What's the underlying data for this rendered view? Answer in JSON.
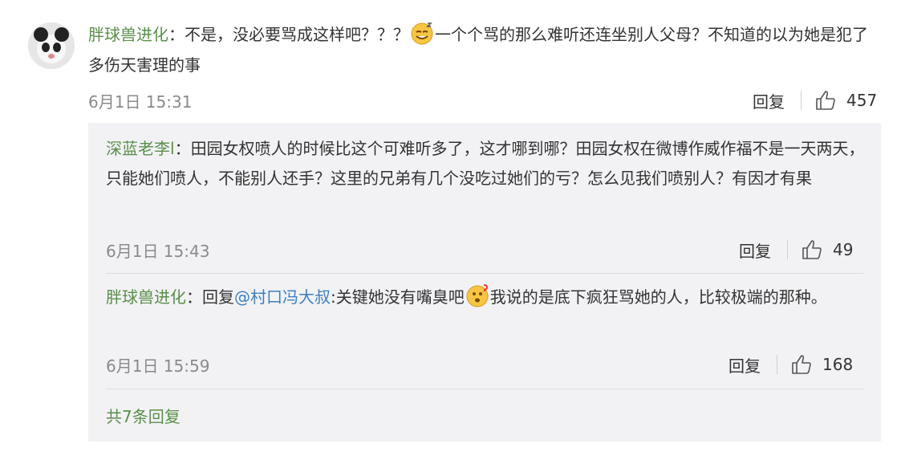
{
  "comment": {
    "username": "胖球兽进化",
    "colon": "：",
    "text_part1": "不是，没必要骂成这样吧？？？",
    "text_part2": "一个个骂的那么难听还连坐别人父母？不知道的以为她是犯了多伤天害理的事",
    "emoji": "sweat-smile-emoji",
    "time": "6月1日 15:31",
    "reply_label": "回复",
    "likes": "457"
  },
  "replies": [
    {
      "username": "深蓝老李l",
      "colon": "：",
      "text": "田园女权喷人的时候比这个可难听多了，这才哪到哪？田园女权在微博作威作福不是一天两天，只能她们喷人，不能别人还手？这里的兄弟有几个没吃过她们的亏？怎么见我们喷别人？有因才有果",
      "time": "6月1日 15:43",
      "reply_label": "回复",
      "likes": "49"
    },
    {
      "username": "胖球兽进化",
      "colon": "：",
      "reply_prefix": "回复",
      "mention": "@村口冯大叔",
      "text_part1": ":关键她没有嘴臭吧",
      "emoji": "confused-emoji",
      "text_part2": "我说的是底下疯狂骂她的人，比较极端的那种。",
      "time": "6月1日 15:59",
      "reply_label": "回复",
      "likes": "168"
    }
  ],
  "total_replies": "共7条回复",
  "colors": {
    "username": "#5a8f4a",
    "link": "#3f7fbf",
    "meta": "#8a8a8a",
    "reply_bg": "#f2f2f5"
  }
}
